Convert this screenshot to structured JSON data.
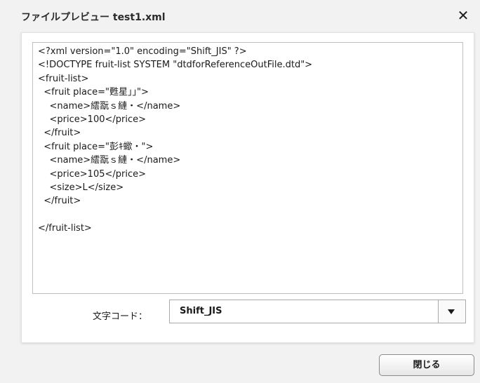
{
  "dialog": {
    "title": "ファイルプレビュー test1.xml",
    "close_icon": "close-icon",
    "close_glyph": "✕"
  },
  "preview": {
    "content": "<?xml version=\"1.0\" encoding=\"Shift_JIS\" ?>\n<!DOCTYPE fruit-list SYSTEM \"dtdforReferenceOutFile.dtd\">\n<fruit-list>\n  <fruit place=\"甦星｣｣\">\n    <name>繧翫ｓ縺・</name>\n    <price>100</price>\n  </fruit>\n  <fruit place=\"彭ｷ蠍・\">\n    <name>繧翫ｓ縺・</name>\n    <price>105</price>\n    <size>L</size>\n  </fruit>\n\n</fruit-list>"
  },
  "encoding": {
    "label": "文字コード：",
    "value": "Shift_JIS",
    "dropdown_icon": "chevron-down-icon"
  },
  "footer": {
    "close_button_label": "閉じる"
  }
}
